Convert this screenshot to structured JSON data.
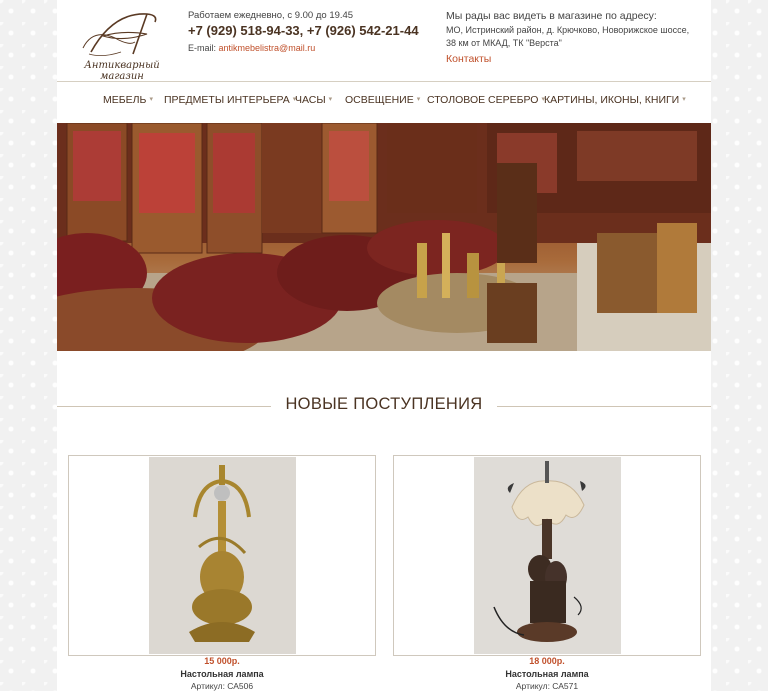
{
  "header": {
    "logo_caption": "Антикварный магазин",
    "hours": "Работаем ежедневно, с 9.00 до 19.45",
    "phones": "+7 (929) 518-94-33, +7 (926) 542-21-44",
    "email_label": "E-mail:",
    "email": "antikmebelistra@mail.ru",
    "address_title": "Мы рады вас видеть в магазине по адресу:",
    "address": "МО, Истринский район, д. Крючково, Новорижское шоссе, 38 км от МКАД, ТК \"Верста\"",
    "contacts_link": "Контакты"
  },
  "nav": {
    "items": [
      {
        "label": "МЕБЕЛЬ"
      },
      {
        "label": "ПРЕДМЕТЫ ИНТЕРЬЕРА"
      },
      {
        "label": "ЧАСЫ"
      },
      {
        "label": "ОСВЕЩЕНИЕ"
      },
      {
        "label": "СТОЛОВОЕ СЕРЕБРО"
      },
      {
        "label": "КАРТИНЫ, ИКОНЫ, КНИГИ"
      }
    ]
  },
  "section": {
    "title": "НОВЫЕ ПОСТУПЛЕНИЯ"
  },
  "products": [
    {
      "price": "15 000р.",
      "name": "Настольная лампа",
      "sku": "Артикул: СА506"
    },
    {
      "price": "18 000р.",
      "name": "Настольная лампа",
      "sku": "Артикул: СА571"
    }
  ],
  "colors": {
    "accent": "#c0502b",
    "brand_brown": "#4a3322"
  }
}
